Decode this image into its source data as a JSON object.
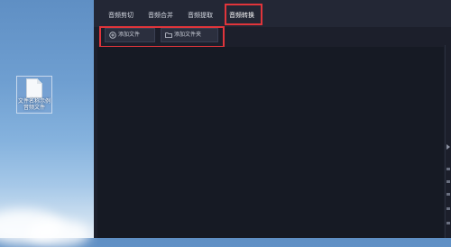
{
  "desktop": {
    "file_label": "文件名称示例\n音频文件"
  },
  "app": {
    "tabs": [
      {
        "label": "音频剪切"
      },
      {
        "label": "音频合并"
      },
      {
        "label": "音频提取"
      },
      {
        "label": "音频转换"
      }
    ],
    "active_tab": "音频转换",
    "toolbar": {
      "add_file_label": "添加文件",
      "add_folder_label": "添加文件夹"
    }
  },
  "icons": {
    "add_file": "plus-circle-icon",
    "add_folder": "folder-icon",
    "desktop_file": "document-icon"
  },
  "colors": {
    "highlight": "#e0353b",
    "window_bg": "#1c1f2b",
    "content_bg": "#161a24"
  }
}
